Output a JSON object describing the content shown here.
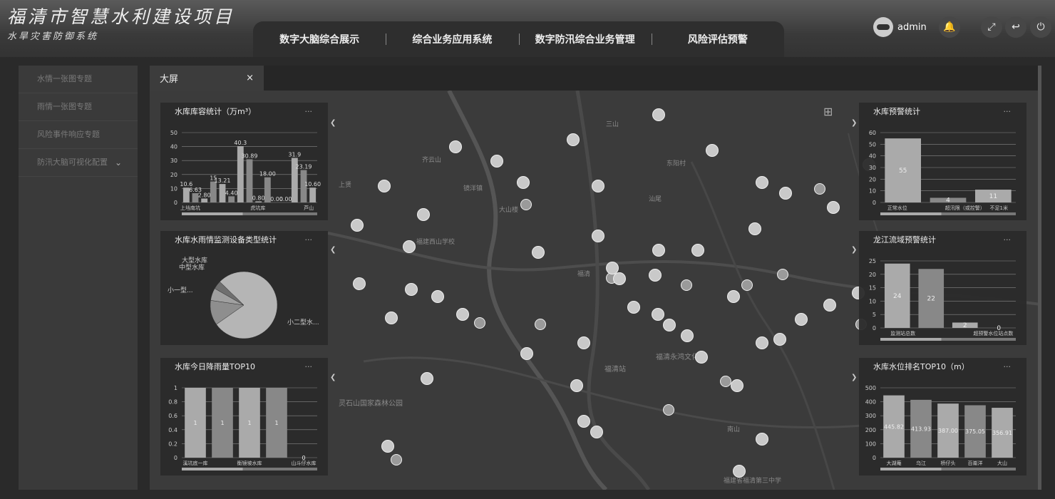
{
  "app": {
    "title": "福清市智慧水利建设项目",
    "subtitle": "水旱灾害防御系统"
  },
  "nav": [
    "数字大脑综合展示",
    "综合业务应用系统",
    "数字防汛综合业务管理",
    "风险评估预警"
  ],
  "user": {
    "name": "admin"
  },
  "sidebar": {
    "items": [
      "水情一张图专题",
      "雨情一张图专题",
      "风险事件响应专题",
      "防汛大脑可视化配置"
    ]
  },
  "tab": {
    "label": "大屏",
    "close": "×"
  },
  "panels": {
    "capacity": {
      "title": "水库库容统计（万m³）",
      "more": "···"
    },
    "deviceType": {
      "title": "水库水雨情监测设备类型统计",
      "more": "···"
    },
    "rainfall": {
      "title": "水库今日降雨量TOP10",
      "more": "···"
    },
    "warning": {
      "title": "水库预警统计",
      "more": "···"
    },
    "basin": {
      "title": "龙江流域预警统计",
      "more": "···"
    },
    "level": {
      "title": "水库水位排名TOP10（m）",
      "more": "···"
    }
  },
  "map_labels": [
    "灵石山国家森林公园",
    "福清永鸿文化城",
    "福清站",
    "齐云山",
    "镜洋镇",
    "大山楼",
    "东阳村",
    "福建省福清第三中学",
    "福建西山学校",
    "南山",
    "上贤",
    "福清",
    "三山",
    "汕尾",
    "莆口"
  ],
  "chart_data": [
    {
      "type": "bar",
      "title": "水库库容统计（万m³）",
      "categories": [
        "上垱南坑",
        "",
        "",
        "",
        "虎坑库",
        "",
        "",
        "芦山"
      ],
      "series": [
        {
          "values": [
            10.6,
            6.63,
            2.8,
            15,
            13.21,
            4.4,
            40.3,
            30.89,
            0.8,
            18.0,
            0.0,
            0.0,
            31.9,
            23.19,
            10.6
          ]
        }
      ],
      "value_labels": [
        "10.6",
        "6.63",
        "2.80",
        "15",
        "13.21",
        "4.40",
        "40.3",
        "30.89",
        "0.80",
        "18.00",
        "0.00",
        "0.00",
        "31.9",
        "23.19",
        "10.60"
      ],
      "ylim": [
        0,
        50
      ],
      "yticks": [
        0,
        10,
        20,
        30,
        40,
        50
      ]
    },
    {
      "type": "pie",
      "title": "水库水雨情监测设备类型统计",
      "labels": [
        "小二型水...",
        "小一型...",
        "中型水库",
        "大型水库"
      ],
      "values": [
        78,
        12,
        6,
        4
      ]
    },
    {
      "type": "bar",
      "title": "水库今日降雨量TOP10",
      "categories": [
        "溪坑底一库",
        "",
        "衡镜坡水库",
        "",
        "山斗仔水库"
      ],
      "values": [
        1,
        1,
        1,
        1,
        0
      ],
      "value_labels": [
        "1",
        "1",
        "1",
        "1",
        "0"
      ],
      "ylim": [
        0,
        1
      ],
      "yticks": [
        "0",
        "0.2",
        "0.4",
        "0.6",
        "0.8",
        "1"
      ]
    },
    {
      "type": "bar",
      "title": "水库预警统计",
      "categories": [
        "正常水位",
        "",
        "超汛限（或控警）",
        "不足1米"
      ],
      "values": [
        55,
        4,
        11
      ],
      "value_labels": [
        "55",
        "4",
        "11"
      ],
      "ylim": [
        0,
        60
      ],
      "yticks": [
        0,
        10,
        20,
        30,
        40,
        50,
        60
      ]
    },
    {
      "type": "bar",
      "title": "龙江流域预警统计",
      "categories": [
        "监测站总数",
        "",
        "超预警水位站点数"
      ],
      "values": [
        24,
        22,
        2,
        0
      ],
      "value_labels": [
        "24",
        "22",
        "2",
        "0"
      ],
      "ylim": [
        0,
        25
      ],
      "yticks": [
        0,
        5,
        10,
        15,
        20,
        25
      ]
    },
    {
      "type": "bar",
      "title": "水库水位排名TOP10（m）",
      "categories": [
        "大湖庵",
        "乌江",
        "桥仔头",
        "百崙洋",
        "大山"
      ],
      "values": [
        445.82,
        413.93,
        387.0,
        375.05,
        356.91
      ],
      "value_labels": [
        "445.82",
        "413.93",
        "387.00",
        "375.05",
        "356.91"
      ],
      "ylim": [
        0,
        500
      ],
      "yticks": [
        0,
        100,
        200,
        300,
        400,
        500
      ]
    }
  ],
  "colors": {
    "bar_light": "#aaaaaa",
    "bar_dark": "#777777",
    "panel": "#2a2a2a",
    "map": "#3b3b3b"
  }
}
